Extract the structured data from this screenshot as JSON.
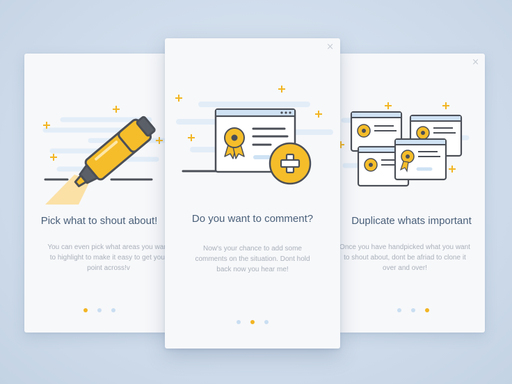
{
  "cards": [
    {
      "title": "Pick what to shout about!",
      "description": "You can even pick what areas you want to highlight to make it easy to get your point across!v",
      "active_dot": 0,
      "illustration": "highlighter-icon"
    },
    {
      "title": "Do you want to comment?",
      "description": "Now's your chance to add some comments on the situation. Dont hold back now you hear me!",
      "active_dot": 1,
      "close_glyph": "×",
      "illustration": "certificate-window-plus-icon"
    },
    {
      "title": "Duplicate whats important",
      "description": "Once you have handpicked what you want to shout about, dont be afriad to clone it over and over!",
      "active_dot": 2,
      "close_glyph": "×",
      "illustration": "duplicate-certificates-icon"
    }
  ],
  "colors": {
    "accent": "#f2b523",
    "dot_inactive": "#c9def1",
    "title": "#4a607a",
    "text": "#a9b0ba",
    "outline": "#4b4f57"
  }
}
